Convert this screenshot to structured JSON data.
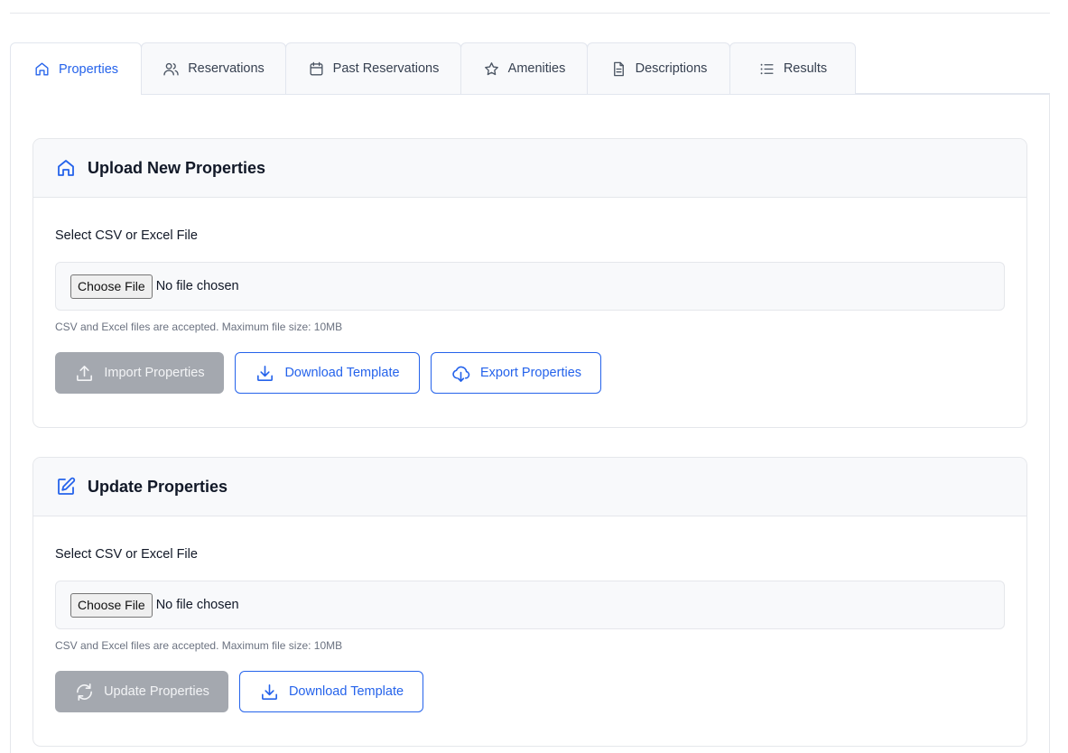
{
  "tabs": [
    {
      "label": "Properties",
      "icon": "home-icon",
      "active": true
    },
    {
      "label": "Reservations",
      "icon": "users-icon",
      "active": false
    },
    {
      "label": "Past Reservations",
      "icon": "calendar-icon",
      "active": false
    },
    {
      "label": "Amenities",
      "icon": "star-icon",
      "active": false
    },
    {
      "label": "Descriptions",
      "icon": "document-icon",
      "active": false
    },
    {
      "label": "Results",
      "icon": "list-icon",
      "active": false
    }
  ],
  "upload_card": {
    "title": "Upload New Properties",
    "icon": "home-icon",
    "field_label": "Select CSV or Excel File",
    "choose_file_label": "Choose File",
    "file_status": "No file chosen",
    "hint": "CSV and Excel files are accepted. Maximum file size: 10MB",
    "import_label": "Import Properties",
    "download_label": "Download Template",
    "export_label": "Export Properties"
  },
  "update_card": {
    "title": "Update Properties",
    "icon": "edit-icon",
    "field_label": "Select CSV or Excel File",
    "choose_file_label": "Choose File",
    "file_status": "No file chosen",
    "hint": "CSV and Excel files are accepted. Maximum file size: 10MB",
    "update_label": "Update Properties",
    "download_label": "Download Template"
  },
  "colors": {
    "accent": "#2563eb",
    "disabled_button": "#a4a8af",
    "header_bg": "#f8f9fb",
    "border": "#e5e7eb"
  }
}
